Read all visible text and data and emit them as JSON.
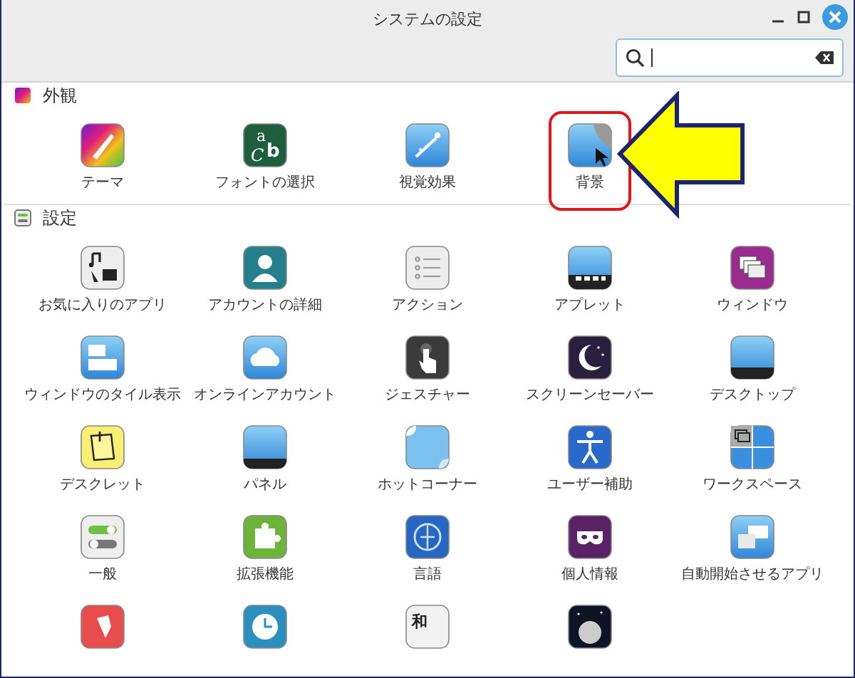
{
  "window": {
    "title": "システムの設定"
  },
  "sections": [
    {
      "title": "外観",
      "items": [
        {
          "label": "テーマ",
          "highlighted": false
        },
        {
          "label": "フォントの選択",
          "highlighted": false,
          "icon_letters": [
            "a",
            "C",
            "b"
          ]
        },
        {
          "label": "視覚効果",
          "highlighted": false
        },
        {
          "label": "背景",
          "highlighted": true
        }
      ]
    },
    {
      "title": "設定",
      "items": [
        {
          "label": "お気に入りのアプリ",
          "highlighted": false
        },
        {
          "label": "アカウントの詳細",
          "highlighted": false
        },
        {
          "label": "アクション",
          "highlighted": false
        },
        {
          "label": "アプレット",
          "highlighted": false
        },
        {
          "label": "ウィンドウ",
          "highlighted": false
        },
        {
          "label": "ウィンドウのタイル表示",
          "highlighted": false
        },
        {
          "label": "オンラインアカウント",
          "highlighted": false
        },
        {
          "label": "ジェスチャー",
          "highlighted": false
        },
        {
          "label": "スクリーンセーバー",
          "highlighted": false
        },
        {
          "label": "デスクトップ",
          "highlighted": false
        },
        {
          "label": "デスクレット",
          "highlighted": false
        },
        {
          "label": "パネル",
          "highlighted": false
        },
        {
          "label": "ホットコーナー",
          "highlighted": false
        },
        {
          "label": "ユーザー補助",
          "highlighted": false
        },
        {
          "label": "ワークスペース",
          "highlighted": false
        },
        {
          "label": "一般",
          "highlighted": false
        },
        {
          "label": "拡張機能",
          "highlighted": false
        },
        {
          "label": "言語",
          "highlighted": false
        },
        {
          "label": "個人情報",
          "highlighted": false
        },
        {
          "label": "自動開始させるアプリ",
          "highlighted": false
        },
        {
          "highlighted": false
        },
        {
          "highlighted": false
        },
        {
          "highlighted": false,
          "icon_letters": [
            "和"
          ]
        },
        {
          "highlighted": false
        }
      ]
    }
  ]
}
